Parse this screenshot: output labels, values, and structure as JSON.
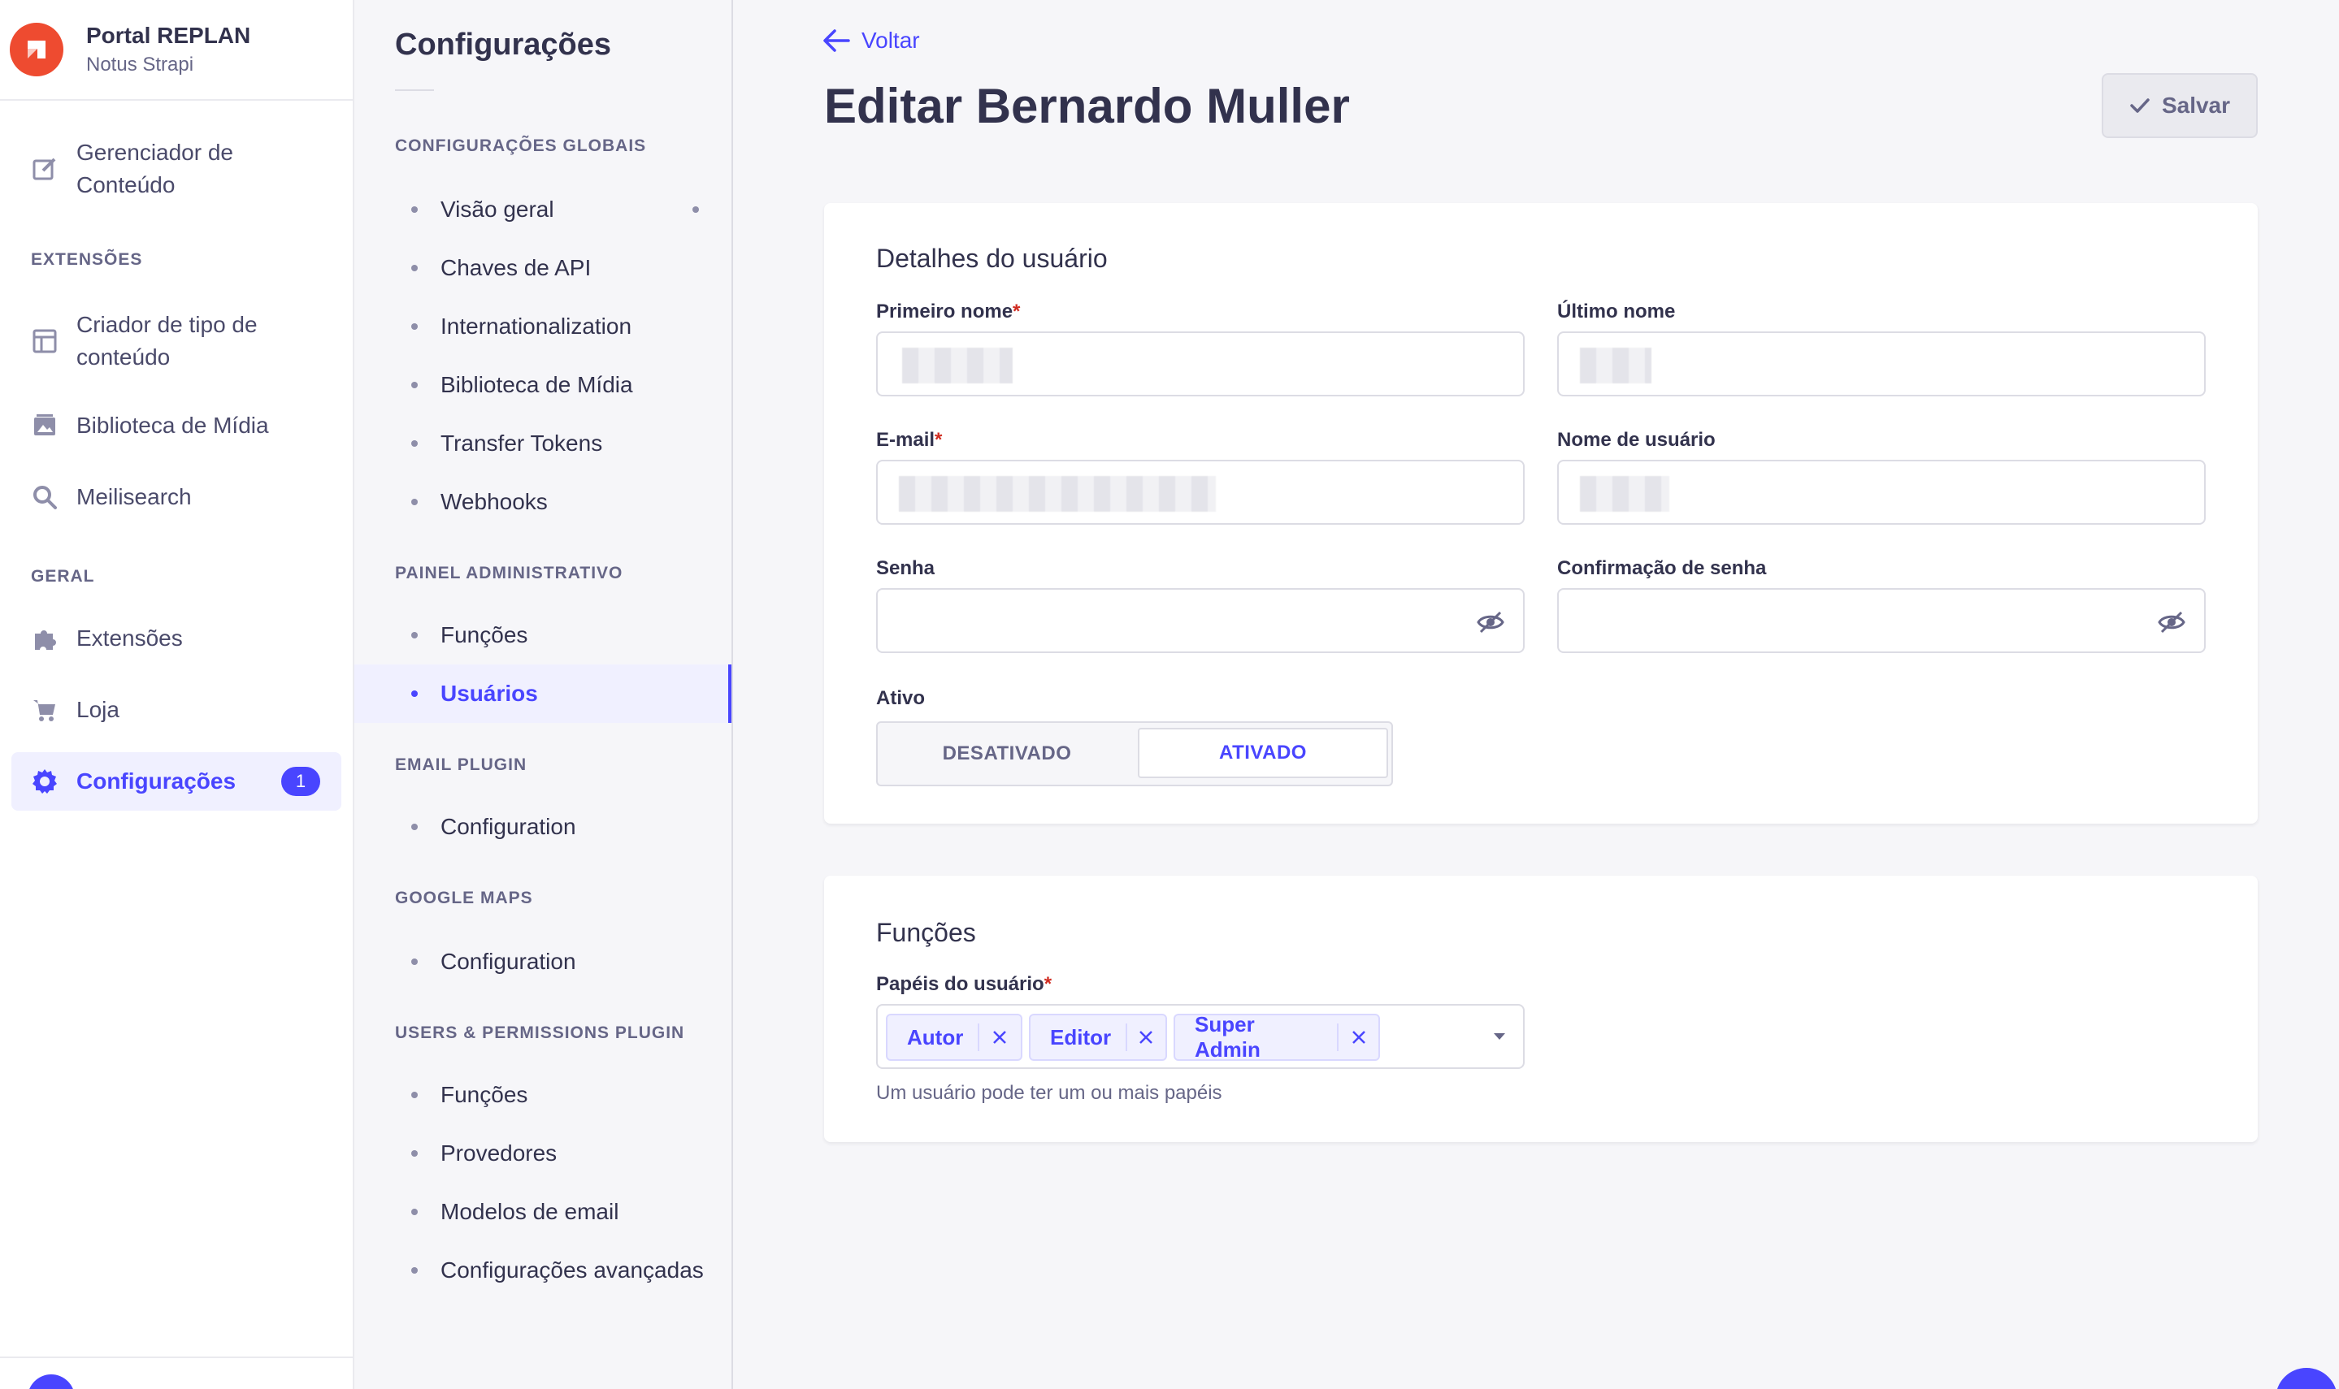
{
  "app": {
    "name": "Portal REPLAN",
    "subtitle": "Notus Strapi"
  },
  "mainnav": {
    "content_manager": "Gerenciador de Conteúdo",
    "section_plugins": "EXTENSÕES",
    "content_type_builder": "Criador de tipo de conteúdo",
    "media_library": "Biblioteca de Mídia",
    "meilisearch": "Meilisearch",
    "section_general": "GERAL",
    "plugins": "Extensões",
    "marketplace": "Loja",
    "settings": "Configurações",
    "settings_badge": "1"
  },
  "subnav": {
    "title": "Configurações",
    "sections": [
      {
        "title": "CONFIGURAÇÕES GLOBAIS",
        "items": [
          "Visão geral",
          "Chaves de API",
          "Internationalization",
          "Biblioteca de Mídia",
          "Transfer Tokens",
          "Webhooks"
        ]
      },
      {
        "title": "PAINEL ADMINISTRATIVO",
        "items": [
          "Funções",
          "Usuários"
        ]
      },
      {
        "title": "EMAIL PLUGIN",
        "items": [
          "Configuration"
        ]
      },
      {
        "title": "GOOGLE MAPS",
        "items": [
          "Configuration"
        ]
      },
      {
        "title": "USERS & PERMISSIONS PLUGIN",
        "items": [
          "Funções",
          "Provedores",
          "Modelos de email",
          "Configurações avançadas"
        ]
      }
    ]
  },
  "header": {
    "back_label": "Voltar",
    "title": "Editar Bernardo Muller",
    "save_label": "Salvar"
  },
  "details": {
    "title": "Detalhes do usuário",
    "first_name_label": "Primeiro nome",
    "last_name_label": "Último nome",
    "email_label": "E-mail",
    "username_label": "Nome de usuário",
    "password_label": "Senha",
    "password_confirm_label": "Confirmação de senha",
    "active_label": "Ativo",
    "toggle_off": "DESATIVADO",
    "toggle_on": "ATIVADO",
    "required_mark": "*"
  },
  "roles": {
    "title": "Funções",
    "label": "Papéis do usuário",
    "tags": [
      "Autor",
      "Editor",
      "Super Admin"
    ],
    "hint": "Um usuário pode ter um ou mais papéis"
  },
  "colors": {
    "primary": "#4945ff",
    "brand": "#ee4b30",
    "danger": "#d02b20"
  }
}
